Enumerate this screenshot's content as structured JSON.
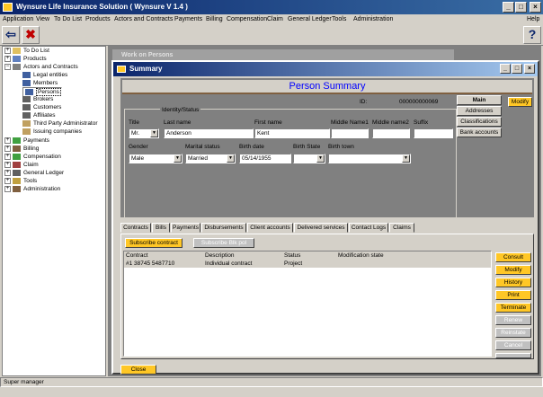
{
  "app": {
    "title": "Wynsure Life Insurance Solution ( Wynsure V 1.4 )",
    "minimize": "_",
    "maximize": "□",
    "close": "×"
  },
  "menu": [
    "Application",
    "View",
    "To Do List",
    "Products",
    "Actors and Contracts",
    "Payments",
    "Billing",
    "Compensation",
    "Claim",
    "General Ledger",
    "Tools",
    "Administration",
    "Help"
  ],
  "toolbar": {
    "back": "⇦",
    "cancel": "✖",
    "help": "?"
  },
  "tree": [
    {
      "label": "To Do List",
      "level": 0,
      "exp": "+",
      "icon": "folder"
    },
    {
      "label": "Products",
      "level": 0,
      "exp": "+",
      "icon": "folder"
    },
    {
      "label": "Actors and Contracts",
      "level": 0,
      "exp": "−",
      "icon": "folder"
    },
    {
      "label": "Legal entities",
      "level": 1,
      "icon": "building"
    },
    {
      "label": "Members",
      "level": 1,
      "icon": "people"
    },
    {
      "label": "Persons",
      "level": 1,
      "icon": "person",
      "selected": true
    },
    {
      "label": "Brokers",
      "level": 1,
      "icon": "broker"
    },
    {
      "label": "Customers",
      "level": 1,
      "icon": "customer"
    },
    {
      "label": "Affiliates",
      "level": 1,
      "icon": "affiliate"
    },
    {
      "label": "Third Party Administrator",
      "level": 1,
      "icon": "tpa"
    },
    {
      "label": "Issuing companies",
      "level": 1,
      "icon": "company"
    },
    {
      "label": "Payments",
      "level": 0,
      "exp": "+",
      "icon": "payment"
    },
    {
      "label": "Billing",
      "level": 0,
      "exp": "+",
      "icon": "billing"
    },
    {
      "label": "Compensation",
      "level": 0,
      "exp": "+",
      "icon": "compensation"
    },
    {
      "label": "Claim",
      "level": 0,
      "exp": "+",
      "icon": "claim"
    },
    {
      "label": "General Ledger",
      "level": 0,
      "exp": "+",
      "icon": "ledger"
    },
    {
      "label": "Tools",
      "level": 0,
      "exp": "+",
      "icon": "tools"
    },
    {
      "label": "Administration",
      "level": 0,
      "exp": "+",
      "icon": "admin"
    }
  ],
  "bg_window": {
    "title": "Work on Persons"
  },
  "summary": {
    "title": "Summary",
    "heading": "Person Summary",
    "id_label": "ID:",
    "id_value": "000000000069",
    "modify": "Modify",
    "group_label": "Identity/Status",
    "right_tabs": [
      "Main",
      "Addresses",
      "Classifications",
      "Bank accounts"
    ],
    "fields": {
      "title_label": "Title",
      "title_value": "Mr.",
      "last_name_label": "Last name",
      "last_name_value": "Anderson",
      "first_name_label": "First name",
      "first_name_value": "Kent",
      "middle1_label": "Middle Name1",
      "middle1_value": "",
      "middle2_label": "Middle name2",
      "middle2_value": "",
      "suffix_label": "Suffix",
      "suffix_value": "",
      "gender_label": "Gender",
      "gender_value": "Male",
      "marital_label": "Marital status",
      "marital_value": "Married",
      "birth_date_label": "Birth date",
      "birth_date_value": "05/14/1955",
      "birth_state_label": "Birth State",
      "birth_state_value": "",
      "birth_town_label": "Birth town",
      "birth_town_value": ""
    },
    "bottom_tabs": [
      "Contracts",
      "Bills",
      "Payments",
      "Disbursements",
      "Client accounts",
      "Delivered services",
      "Contact Logs",
      "Claims"
    ],
    "subscribe": "Subscribe contract",
    "disabled_top": "Subscribe Blk pol",
    "table": {
      "headers": [
        "Contract",
        "Description",
        "Status",
        "Modification state"
      ],
      "rows": [
        [
          "#1 38745 5487710",
          "Individual contract",
          "Project",
          ""
        ]
      ]
    },
    "side_buttons": [
      "Consult",
      "Modify",
      "History",
      "Print",
      "Terminate"
    ],
    "disabled_buttons": [
      "Renew",
      "Reinstate",
      "Cancel",
      "Lapse"
    ],
    "close": "Close"
  },
  "status": "Super manager",
  "colors": {
    "accent": "#ffc726",
    "titlebar": "#0a246a",
    "heading": "#0000ff"
  }
}
